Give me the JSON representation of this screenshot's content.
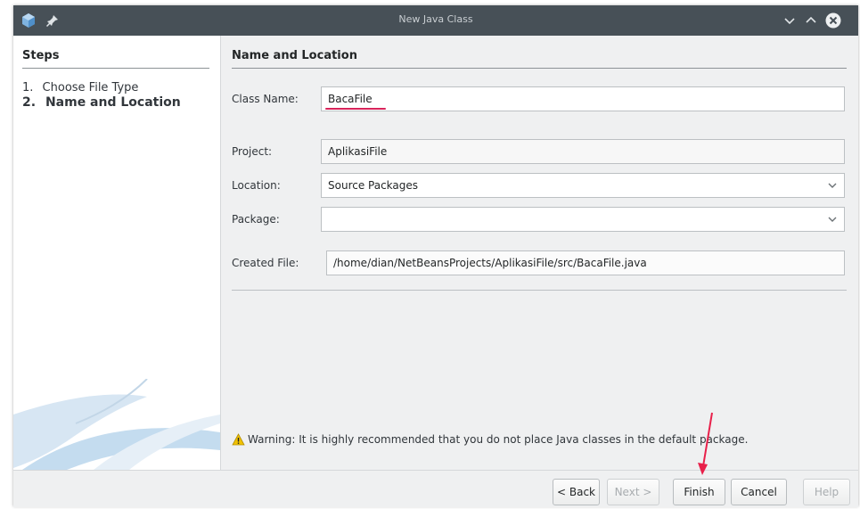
{
  "window": {
    "title": "New Java Class"
  },
  "steps": {
    "heading": "Steps",
    "items": [
      {
        "number": "1.",
        "label": "Choose File Type"
      },
      {
        "number": "2.",
        "label": "Name and Location"
      }
    ]
  },
  "panel": {
    "heading": "Name and Location",
    "class_name": {
      "label": "Class Name:",
      "value": "BacaFile"
    },
    "project": {
      "label": "Project:",
      "value": "AplikasiFile"
    },
    "location": {
      "label": "Location:",
      "value": "Source Packages"
    },
    "package": {
      "label": "Package:",
      "value": ""
    },
    "created_file": {
      "label": "Created File:",
      "value": "/home/dian/NetBeansProjects/AplikasiFile/src/BacaFile.java"
    },
    "warning": "Warning: It is highly recommended that you do not place Java classes in the default package."
  },
  "buttons": {
    "back": "< Back",
    "next": "Next >",
    "finish": "Finish",
    "cancel": "Cancel",
    "help": "Help"
  },
  "colors": {
    "titlebar": "#475057",
    "focus_underline": "#d8245a",
    "warning_icon": "#f2c200",
    "annotation_arrow": "#e8204a"
  }
}
